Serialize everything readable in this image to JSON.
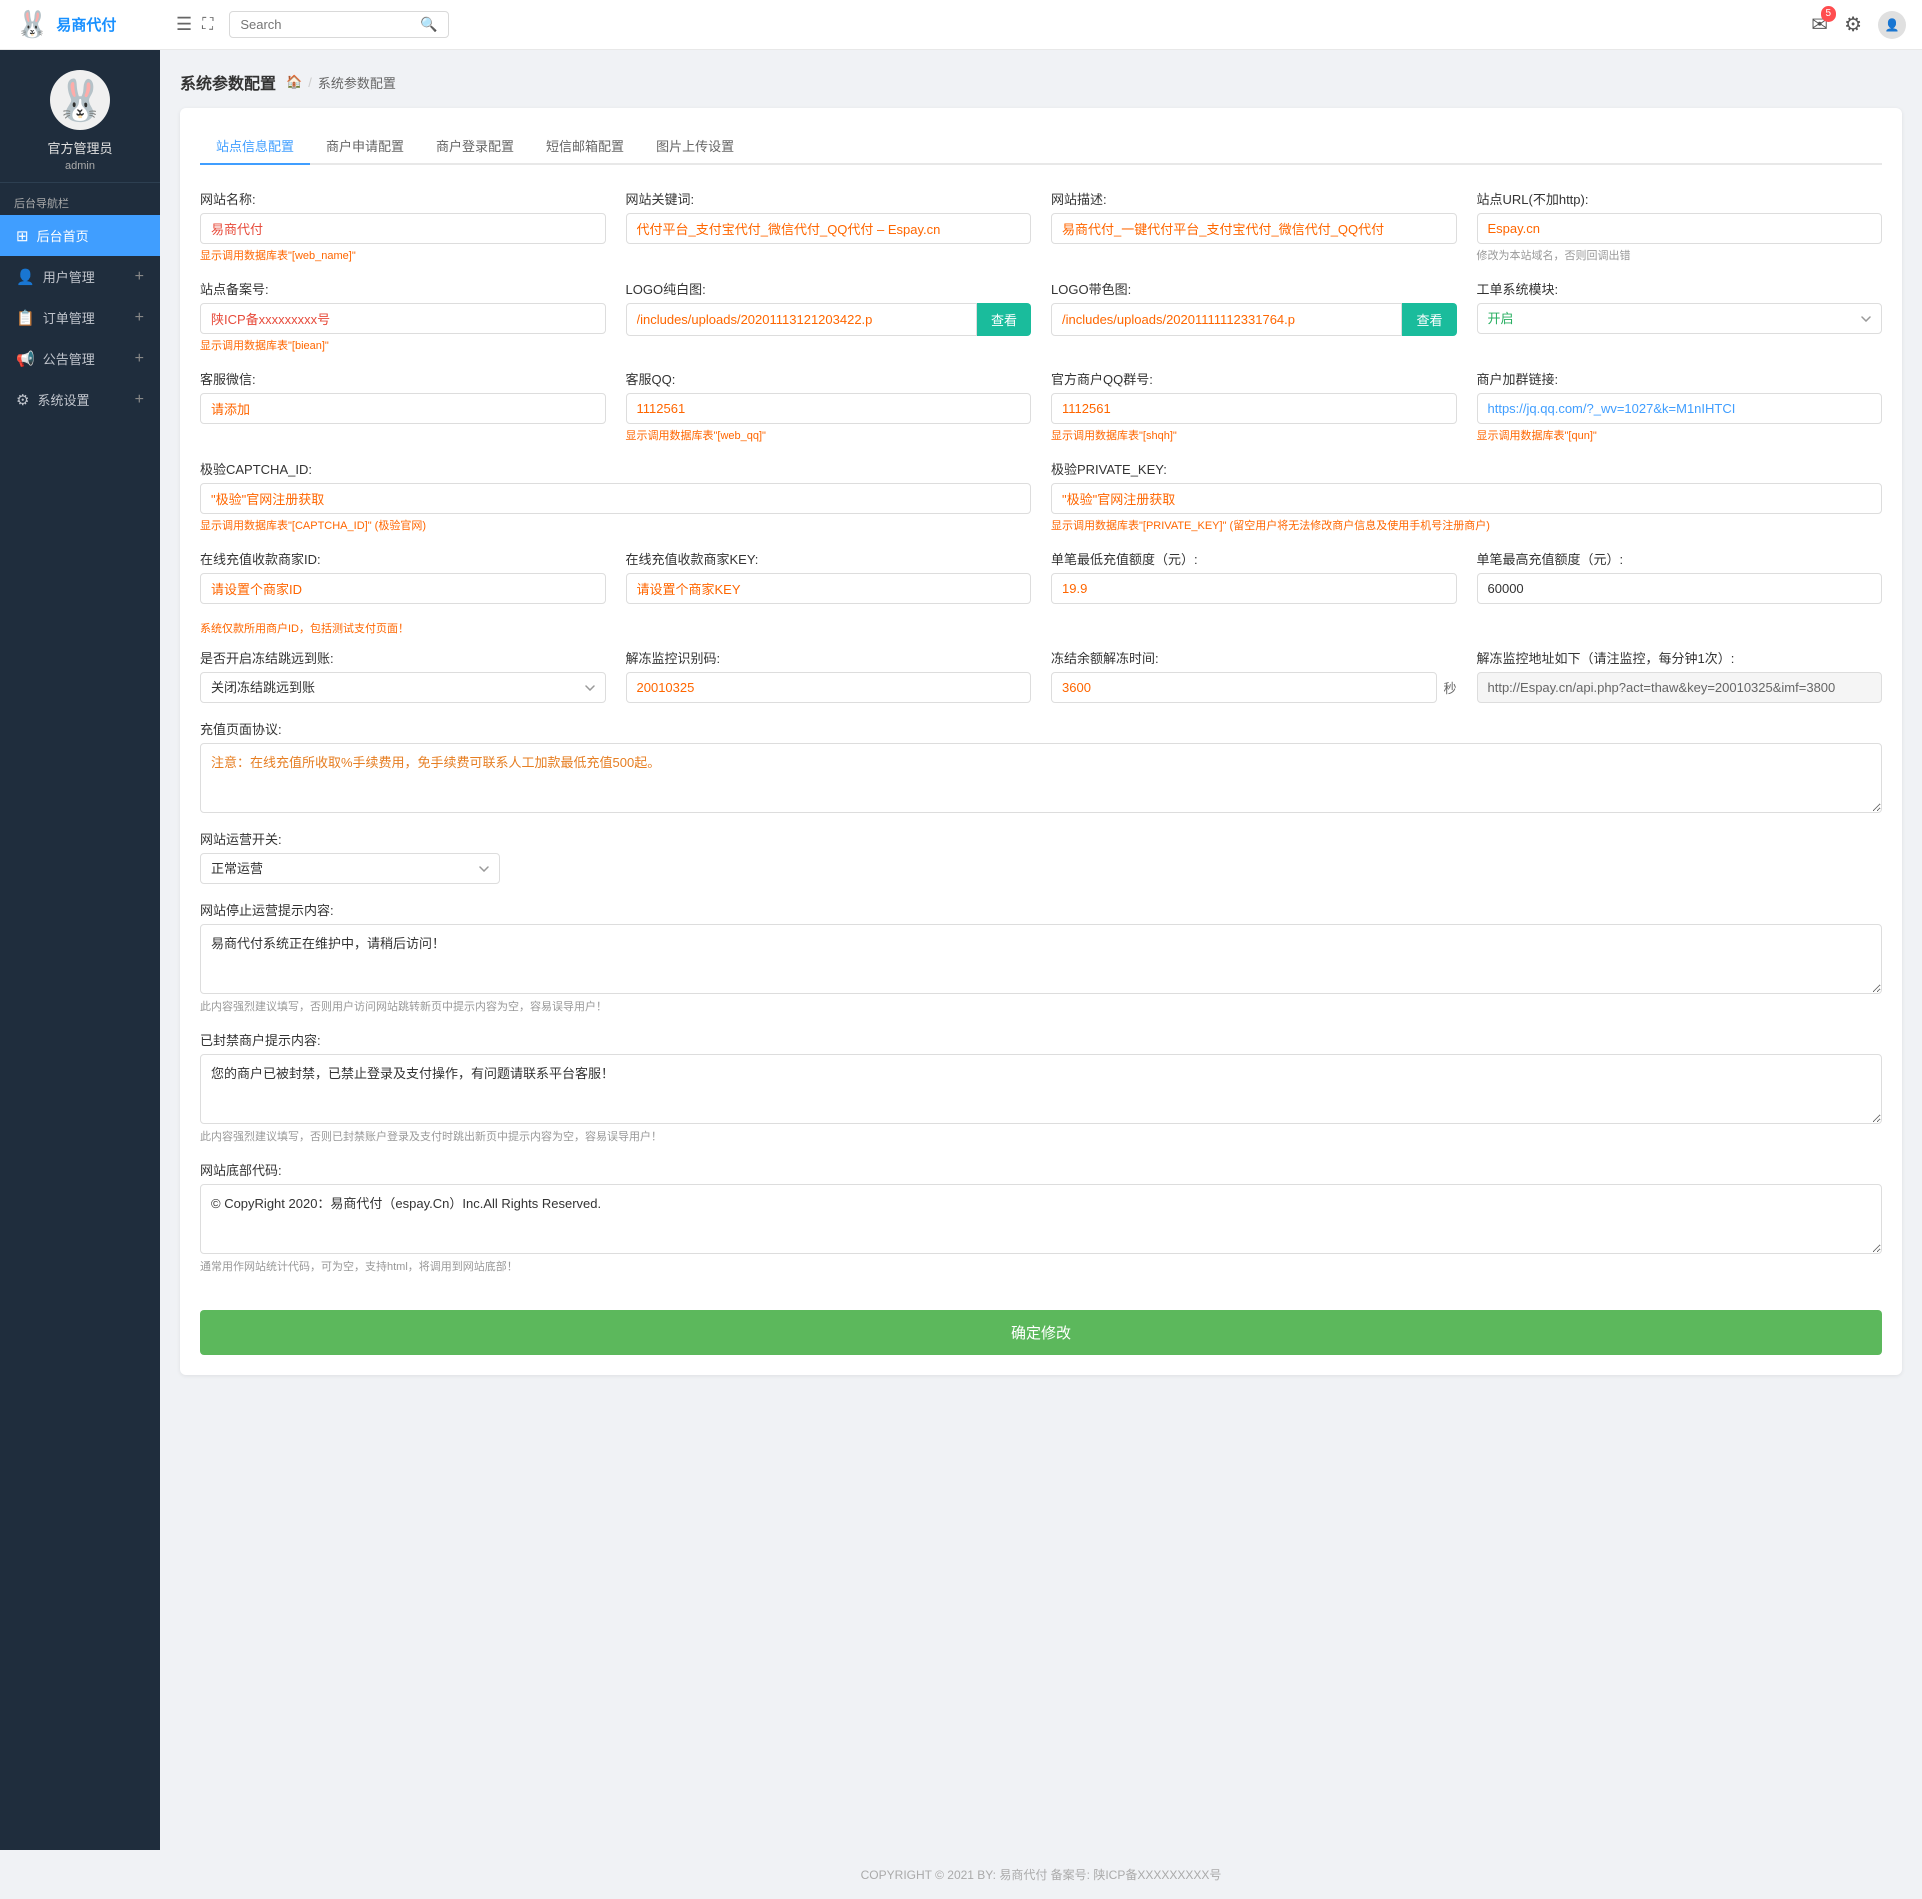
{
  "app": {
    "logo_text": "易商代付",
    "title": "系统参数配置"
  },
  "topbar": {
    "search_placeholder": "Search",
    "notification_count": "5",
    "settings_icon": "⚙",
    "avatar_icon": "👤"
  },
  "sidebar": {
    "username": "官方管理员",
    "role": "admin",
    "nav_title": "后台导航栏",
    "items": [
      {
        "id": "dashboard",
        "label": "后台首页",
        "icon": "⊞",
        "active": true
      },
      {
        "id": "users",
        "label": "用户管理",
        "icon": "👤",
        "plus": true
      },
      {
        "id": "orders",
        "label": "订单管理",
        "icon": "📋",
        "plus": true
      },
      {
        "id": "announcements",
        "label": "公告管理",
        "icon": "📢",
        "plus": true
      },
      {
        "id": "settings",
        "label": "系统设置",
        "icon": "⚙",
        "plus": true
      }
    ]
  },
  "breadcrumb": {
    "page_title": "系统参数配置",
    "home_icon": "🏠",
    "separator": "/",
    "current": "系统参数配置"
  },
  "tabs": [
    {
      "id": "site-info",
      "label": "站点信息配置",
      "active": true
    },
    {
      "id": "merchant-apply",
      "label": "商户申请配置",
      "active": false
    },
    {
      "id": "merchant-login",
      "label": "商户登录配置",
      "active": false
    },
    {
      "id": "email",
      "label": "短信邮箱配置",
      "active": false
    },
    {
      "id": "image-upload",
      "label": "图片上传设置",
      "active": false
    }
  ],
  "form": {
    "site_name_label": "网站名称:",
    "site_name_value": "易商代付",
    "site_name_hint": "显示调用数据库表\"[web_name]\"",
    "site_keyword_label": "网站关键词:",
    "site_keyword_value": "代付平台_支付宝代付_微信代付_QQ代付 – Espay.cn",
    "site_desc_label": "网站描述:",
    "site_desc_value": "易商代付_一键代付平台_支付宝代付_微信代付_QQ代付",
    "site_url_label": "站点URL(不加http):",
    "site_url_value": "Espay.cn",
    "site_url_hint": "修改为本站域名，否则回调出错",
    "site_icp_label": "站点备案号:",
    "site_icp_value": "陕ICP备xxxxxxxxx号",
    "site_icp_hint": "显示调用数据库表\"[biean]\"",
    "logo_white_label": "LOGO纯白图:",
    "logo_white_value": "/includes/uploads/20201113121203422.p",
    "logo_white_btn": "查看",
    "logo_color_label": "LOGO带色图:",
    "logo_color_value": "/includes/uploads/20201111112331764.p",
    "logo_color_btn": "查看",
    "work_module_label": "工单系统模块:",
    "work_module_value": "开启",
    "wechat_label": "客服微信:",
    "wechat_value": "请添加",
    "qq_label": "客服QQ:",
    "qq_value": "1112561",
    "qq_hint": "显示调用数据库表\"[web_qq]\"",
    "official_qq_label": "官方商户QQ群号:",
    "official_qq_value": "1112561",
    "official_qq_hint": "显示调用数据库表\"[shqh]\"",
    "join_group_label": "商户加群链接:",
    "join_group_value": "https://jq.qq.com/?_wv=1027&k=M1nIHTCI",
    "join_group_hint": "显示调用数据库表\"[qun]\"",
    "captcha_id_label": "极验CAPTCHA_ID:",
    "captcha_id_value": "\"极验\"官网注册获取",
    "captcha_id_hint": "显示调用数据库表\"[CAPTCHA_ID]\" (极验官网)",
    "captcha_key_label": "极验PRIVATE_KEY:",
    "captcha_key_value": "\"极验\"官网注册获取",
    "captcha_key_hint": "显示调用数据库表\"[PRIVATE_KEY]\" (留空用户将无法修改商户信息及使用手机号注册商户)",
    "merchant_id_label": "在线充值收款商家ID:",
    "merchant_id_value": "请设置个商家ID",
    "merchant_id_hint": "系统仅款所用商户ID，包括测试支付页面！",
    "merchant_key_label": "在线充值收款商家KEY:",
    "merchant_key_value": "请设置个商家KEY",
    "min_recharge_label": "单笔最低充值额度（元）:",
    "min_recharge_value": "19.9",
    "max_recharge_label": "单笔最高充值额度（元）:",
    "max_recharge_value": "60000",
    "freeze_redirect_label": "是否开启冻结跳远到账:",
    "freeze_redirect_value": "关闭冻结跳远到账",
    "thaw_captcha_label": "解冻监控识别码:",
    "thaw_captcha_value": "20010325",
    "thaw_time_label": "冻结余额解冻时间:",
    "thaw_time_value": "3600",
    "thaw_time_unit": "秒",
    "thaw_url_label": "解冻监控地址如下（请注监控，每分钟1次）:",
    "thaw_url_value": "http://Espay.cn/api.php?act=thaw&key=20010325&imf=3800",
    "recharge_agreement_label": "充值页面协议:",
    "recharge_agreement_value": "注意：在线充值所收取%手续费用，免手续费可联系人工加款最低充值500起。",
    "site_running_label": "网站运营开关:",
    "site_running_value": "正常运营",
    "site_stop_notice_label": "网站停止运营提示内容:",
    "site_stop_notice_value": "易商代付系统正在维护中，请稍后访问！",
    "site_stop_notice_hint": "此内容强烈建议填写，否则用户访问网站跳转新页中提示内容为空，容易误导用户！",
    "banned_notice_label": "已封禁商户提示内容:",
    "banned_notice_value": "您的商户已被封禁，已禁止登录及支付操作，有问题请联系平台客服！",
    "banned_notice_hint": "此内容强烈建议填写，否则已封禁账户登录及支付时跳出新页中提示内容为空，容易误导用户！",
    "copyright_label": "网站底部代码:",
    "copyright_value": "© CopyRight 2020：易商代付（espay.Cn）Inc.All Rights Reserved.",
    "copyright_hint": "通常用作网站统计代码，可为空，支持html，将调用到网站底部！",
    "submit_btn": "确定修改"
  },
  "footer": {
    "copyright": "COPYRIGHT © 2021  BY: 易商代付   备案号: 陕ICP备XXXXXXXXX号"
  }
}
